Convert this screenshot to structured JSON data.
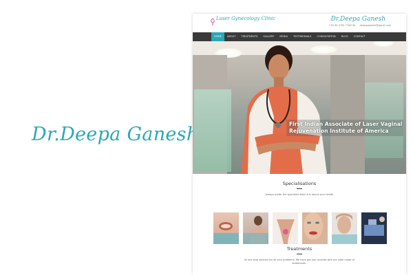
{
  "brand_name": "Dr.Deepa Ganesh",
  "site": {
    "logo_text": "Laser Gynecology Clinic",
    "doctor_name": "Dr.Deepa Ganesh",
    "phone": "+91 80 2781 7765 00",
    "email": "deepaganesh@gmail.com",
    "nav": [
      "HOME",
      "ABOUT",
      "TREATMENTS",
      "GALLERY",
      "MEDIA",
      "TESTIMONIALS",
      "CONSULTATION",
      "BLOG",
      "CONTACT"
    ],
    "active_nav": "HOME",
    "hero_caption_line1": "First Indian Associate of Laser Vaginal",
    "hero_caption_line2": "Rejuvenation Institute of America",
    "specialisations": {
      "title": "Specialisations",
      "subtitle": "Always prefer the specialist when it is about your health"
    },
    "treatments": {
      "title": "Treatments",
      "subtitle_line1": "At one stop solution for all your problems. We have got you covered with our wide range of",
      "subtitle_line2": "treatments."
    },
    "accent_color": "#2aa7b7",
    "nav_background": "#3a3a3a"
  }
}
